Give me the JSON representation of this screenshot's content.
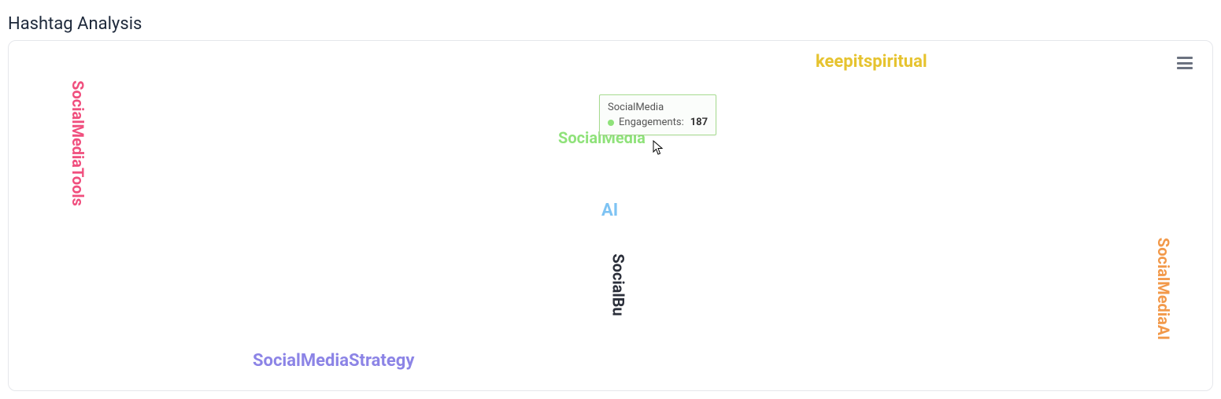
{
  "title": "Hashtag Analysis",
  "tooltip": {
    "name": "SocialMedia",
    "metric_label": "Engagements:",
    "value": "187"
  },
  "words": {
    "socialmediatools": "SocialMediaTools",
    "keepitspiritual": "keepitspiritual",
    "socialmedia": "SocialMedia",
    "ai": "AI",
    "socialbu": "SocialBu",
    "socialmediastrategy": "SocialMediaStrategy",
    "socialmediaai": "SocialMediaAI"
  },
  "chart_data": {
    "type": "wordcloud",
    "title": "Hashtag Analysis",
    "metric": "Engagements",
    "series": [
      {
        "name": "SocialMediaTools",
        "value": null,
        "color": "#f04f7e",
        "orientation": "vertical"
      },
      {
        "name": "keepitspiritual",
        "value": null,
        "color": "#e6c32f",
        "orientation": "horizontal"
      },
      {
        "name": "SocialMedia",
        "value": 187,
        "color": "#8fe27a",
        "orientation": "horizontal"
      },
      {
        "name": "AI",
        "value": null,
        "color": "#7ec3f3",
        "orientation": "horizontal"
      },
      {
        "name": "SocialBu",
        "value": null,
        "color": "#2b2f3a",
        "orientation": "vertical"
      },
      {
        "name": "SocialMediaStrategy",
        "value": null,
        "color": "#8c84e6",
        "orientation": "horizontal"
      },
      {
        "name": "SocialMediaAI",
        "value": null,
        "color": "#f2994a",
        "orientation": "vertical"
      }
    ]
  }
}
